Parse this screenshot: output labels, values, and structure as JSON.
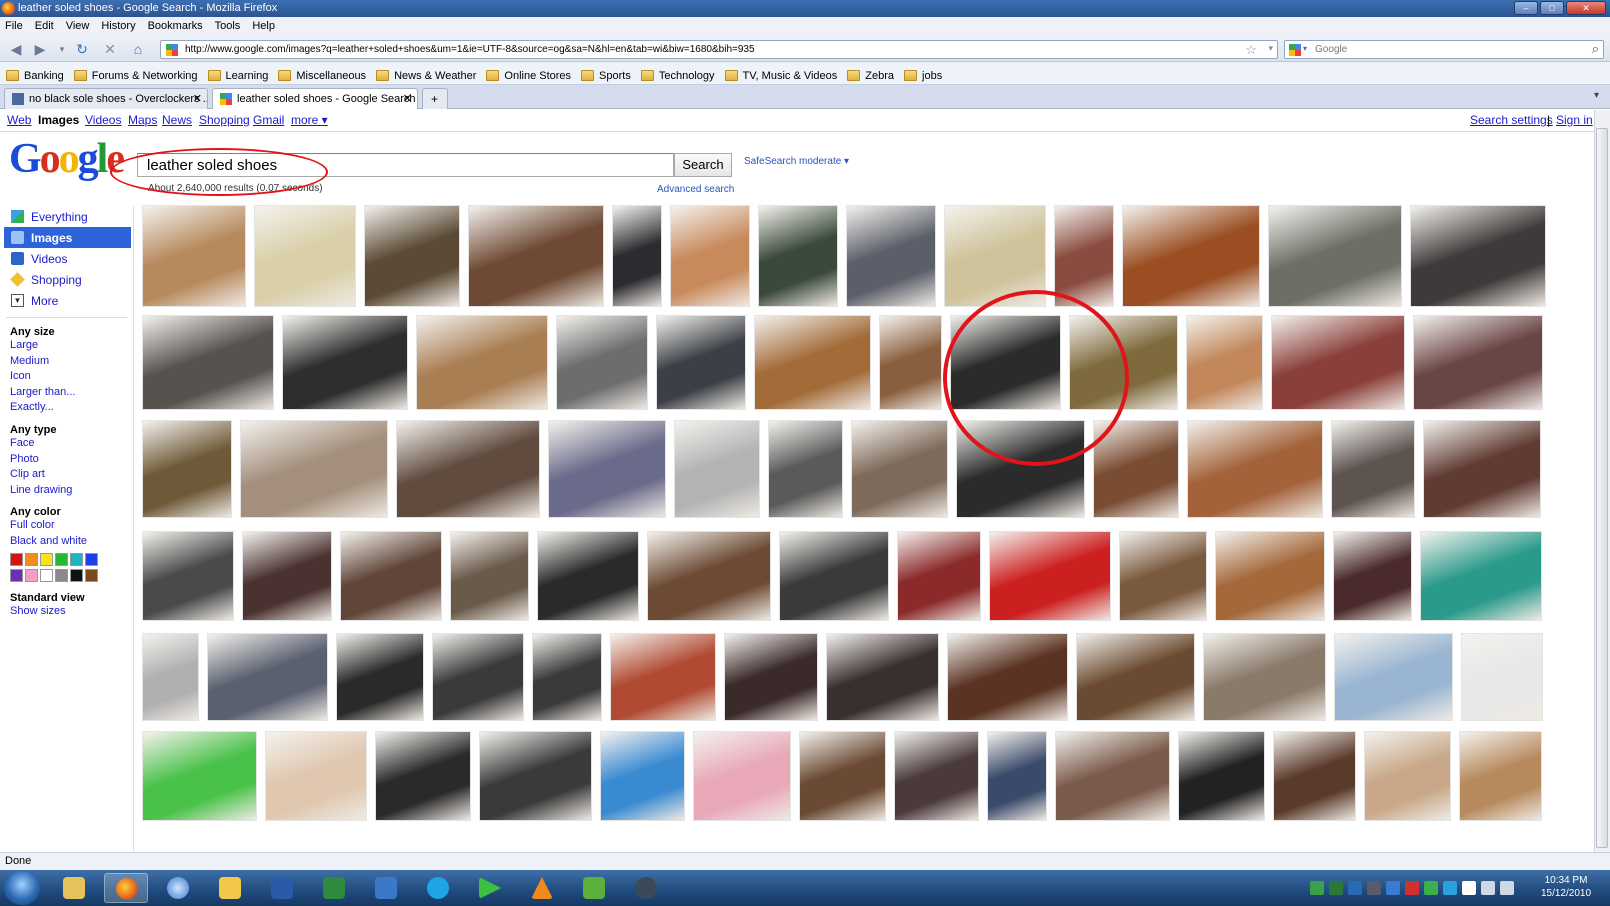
{
  "window": {
    "title": "leather soled shoes - Google Search - Mozilla Firefox"
  },
  "menu": [
    "File",
    "Edit",
    "View",
    "History",
    "Bookmarks",
    "Tools",
    "Help"
  ],
  "navbar": {
    "url": "http://www.google.com/images?q=leather+soled+shoes&um=1&ie=UTF-8&source=og&sa=N&hl=en&tab=wi&biw=1680&bih=935",
    "search_placeholder": "Google"
  },
  "bookmarks": [
    "Banking",
    "Forums & Networking",
    "Learning",
    "Miscellaneous",
    "News & Weather",
    "Online Stores",
    "Sports",
    "Technology",
    "TV, Music & Videos",
    "Zebra",
    "jobs"
  ],
  "tabs": [
    {
      "label": "no black sole shoes - Overclockers ..."
    },
    {
      "label": "leather soled shoes - Google Search"
    }
  ],
  "gbar": {
    "left": [
      "Web",
      "Images",
      "Videos",
      "Maps",
      "News",
      "Shopping",
      "Gmail",
      "more ▾"
    ],
    "settings": "Search settings",
    "signin": "Sign in"
  },
  "search": {
    "query": "leather soled shoes",
    "button": "Search",
    "safesearch": "SafeSearch moderate ▾",
    "results": "About 2,640,000 results (0.07 seconds)",
    "advanced": "Advanced search"
  },
  "leftnav": {
    "items": [
      "Everything",
      "Images",
      "Videos",
      "Shopping",
      "More"
    ],
    "size_head": "Any size",
    "sizes": [
      "Large",
      "Medium",
      "Icon",
      "Larger than...",
      "Exactly..."
    ],
    "type_head": "Any type",
    "types": [
      "Face",
      "Photo",
      "Clip art",
      "Line drawing"
    ],
    "color_head": "Any color",
    "colors": [
      "Full color",
      "Black and white"
    ],
    "swatch_colors": [
      "#d61313",
      "#f58c1e",
      "#f7e21c",
      "#27b736",
      "#1db5c4",
      "#1f3ee6",
      "#6b2fb4",
      "#f2a0c8",
      "#ffffff",
      "#8a8a8a",
      "#111111",
      "#7a4a1e"
    ],
    "view_head": "Standard view",
    "view_link": "Show sizes"
  },
  "status": "Done",
  "clock": {
    "time": "10:34 PM",
    "date": "15/12/2010"
  },
  "thumbs": [
    {
      "c": "#b78a5e"
    },
    {
      "c": "#d9cfa8"
    },
    {
      "c": "#5b4a35"
    },
    {
      "c": "#6e4a34"
    },
    {
      "c": "#2c2c30"
    },
    {
      "c": "#c88a5c"
    },
    {
      "c": "#3a4a3a"
    },
    {
      "c": "#5b5f69"
    },
    {
      "c": "#cfc39b"
    },
    {
      "c": "#8a4c40"
    },
    {
      "c": "#9a4e22"
    },
    {
      "c": "#6c6f66"
    },
    {
      "c": "#3e3a3a"
    },
    {
      "c": "#56524e"
    },
    {
      "c": "#2e2e2e"
    },
    {
      "c": "#a97e53"
    },
    {
      "c": "#6d6d6d"
    },
    {
      "c": "#3c4046"
    },
    {
      "c": "#a26b38"
    },
    {
      "c": "#8a5f3f"
    },
    {
      "c": "#2b2b2b"
    },
    {
      "c": "#7e6a3d"
    },
    {
      "c": "#c2875b"
    },
    {
      "c": "#8a3f3a"
    },
    {
      "c": "#6a4545"
    },
    {
      "c": "#6e5a38"
    },
    {
      "c": "#a38f7c"
    },
    {
      "c": "#604b3e"
    },
    {
      "c": "#6a6a8a"
    },
    {
      "c": "#b3b3b3"
    },
    {
      "c": "#5a5a5a"
    },
    {
      "c": "#7e6a5a"
    },
    {
      "c": "#2b2b2b"
    },
    {
      "c": "#7a4d33"
    },
    {
      "c": "#a3623a"
    },
    {
      "c": "#5d5450"
    },
    {
      "c": "#5f3b32"
    },
    {
      "c": "#4a4a4a"
    },
    {
      "c": "#4a3230"
    },
    {
      "c": "#604538"
    },
    {
      "c": "#6a5a4a"
    },
    {
      "c": "#2a2a2a"
    },
    {
      "c": "#6c4a34"
    },
    {
      "c": "#3a3a3a"
    },
    {
      "c": "#8a2a2a"
    },
    {
      "c": "#cc1f1f"
    },
    {
      "c": "#7a5a3f"
    },
    {
      "c": "#a4683b"
    },
    {
      "c": "#4a2a2a"
    },
    {
      "c": "#2a9a8a"
    },
    {
      "c": "#b0b0b0"
    },
    {
      "c": "#5a6070"
    },
    {
      "c": "#2a2a2a"
    },
    {
      "c": "#3a3a3a"
    },
    {
      "c": "#3a3a3a"
    },
    {
      "c": "#b04a32"
    },
    {
      "c": "#3a2a2a"
    },
    {
      "c": "#3a2f2f"
    },
    {
      "c": "#5a3322"
    },
    {
      "c": "#6a4a30"
    },
    {
      "c": "#8a7a6a"
    },
    {
      "c": "#9ab5d2"
    },
    {
      "c": "#e8e8e8"
    },
    {
      "c": "#4ac24a"
    },
    {
      "c": "#e0c7b0"
    },
    {
      "c": "#2a2a2a"
    },
    {
      "c": "#3a3a3a"
    },
    {
      "c": "#3a8ad2"
    },
    {
      "c": "#e8a8b8"
    },
    {
      "c": "#6a4a34"
    },
    {
      "c": "#4a3a3a"
    },
    {
      "c": "#3a4a6a"
    },
    {
      "c": "#7a5a4a"
    },
    {
      "c": "#222222"
    },
    {
      "c": "#5a3a2a"
    },
    {
      "c": "#c8a888"
    }
  ]
}
